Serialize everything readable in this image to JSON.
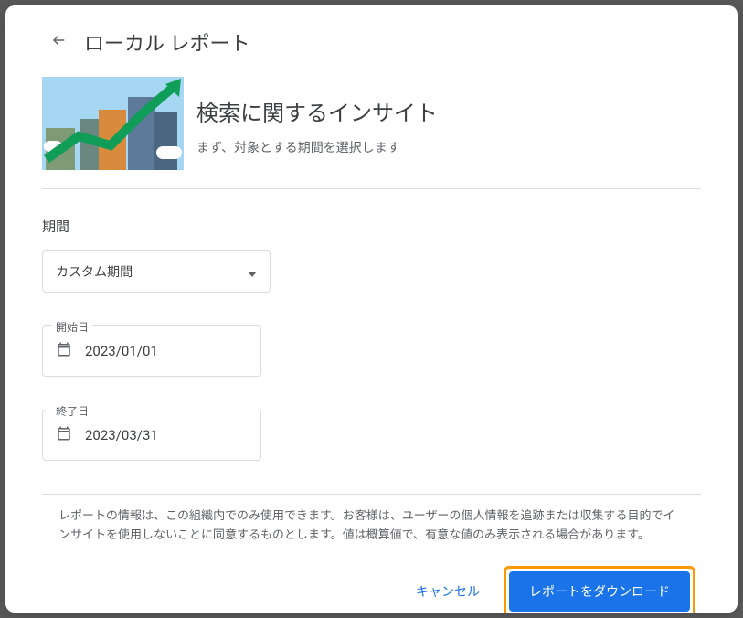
{
  "header": {
    "title": "ローカル レポート"
  },
  "hero": {
    "heading": "検索に関するインサイト",
    "subtext": "まず、対象とする期間を選択します"
  },
  "form": {
    "period_label": "期間",
    "period_value": "カスタム期間",
    "start": {
      "label": "開始日",
      "value": "2023/01/01"
    },
    "end": {
      "label": "終了日",
      "value": "2023/03/31"
    }
  },
  "footer": {
    "disclaimer": "レポートの情報は、この組織内でのみ使用できます。お客様は、ユーザーの個人情報を追跡または収集する目的でインサイトを使用しないことに同意するものとします。値は概算値で、有意な値のみ表示される場合があります。",
    "cancel": "キャンセル",
    "download": "レポートをダウンロード"
  }
}
